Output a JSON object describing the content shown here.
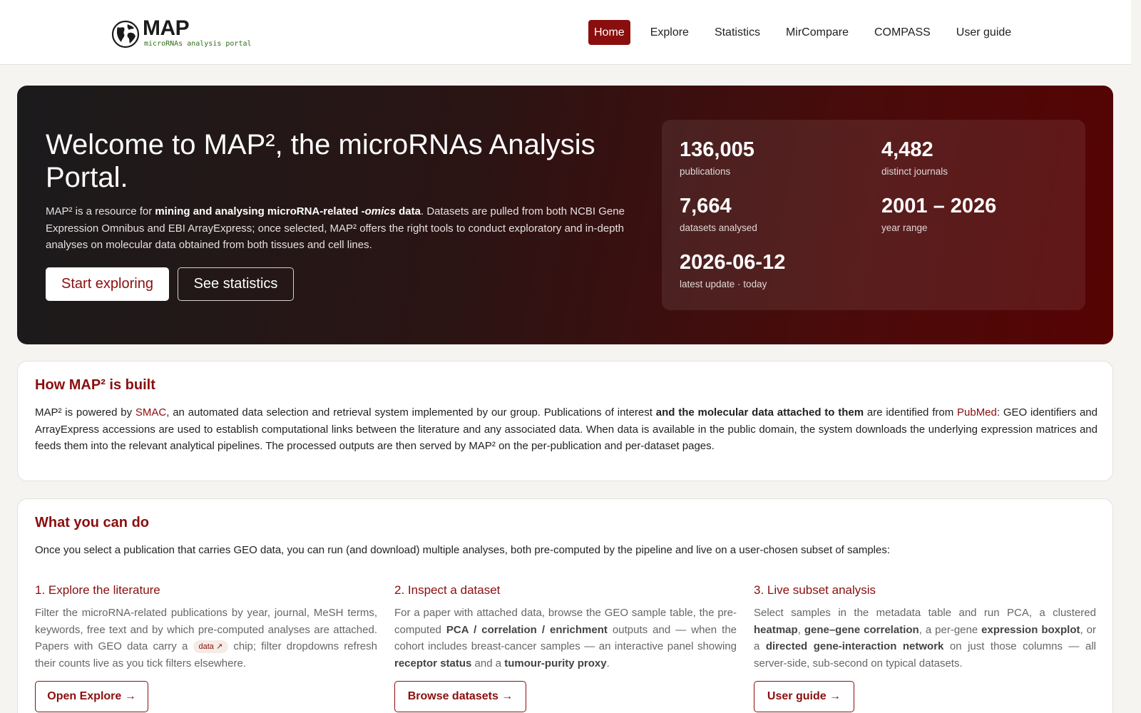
{
  "brand": {
    "logo_text": "MAP",
    "logo_subtitle": "microRNAs analysis portal"
  },
  "nav": [
    {
      "label": "Home",
      "active": true
    },
    {
      "label": "Explore",
      "active": false
    },
    {
      "label": "Statistics",
      "active": false
    },
    {
      "label": "MirCompare",
      "active": false
    },
    {
      "label": "COMPASS",
      "active": false
    },
    {
      "label": "User guide",
      "active": false
    }
  ],
  "hero": {
    "title": "Welcome to MAP², the microRNAs Analysis Portal.",
    "desc_1": "MAP² is a resource for ",
    "desc_bold_1": "mining and analysing microRNA-related ",
    "desc_bold_italic": "-omics",
    "desc_bold_2": " data",
    "desc_2": ". Datasets are pulled from both NCBI Gene Expression Omnibus and EBI ArrayExpress; once selected, MAP² offers the right tools to conduct exploratory and in-depth analyses on molecular data obtained from both tissues and cell lines.",
    "btn_primary": "Start exploring",
    "btn_secondary": "See statistics"
  },
  "stats": [
    {
      "value": "136,005",
      "label": "publications"
    },
    {
      "value": "4,482",
      "label": "distinct journals"
    },
    {
      "value": "7,664",
      "label": "datasets analysed"
    },
    {
      "value": "2001 – 2026",
      "label": "year range"
    },
    {
      "value": "2026-06-12",
      "label": "latest update · today"
    }
  ],
  "built": {
    "title": "How MAP² is built",
    "t1": "MAP² is powered by ",
    "link_smac": "SMAC",
    "t2": ", an automated data selection and retrieval system implemented by our group. Publications of interest ",
    "bold": "and the molecular data attached to them",
    "t3": " are identified from ",
    "link_pubmed": "PubMed",
    "t4": ": GEO identifiers and ArrayExpress accessions are used to establish computational links between the literature and any associated data. When data is available in the public domain, the system downloads the underlying expression matrices and feeds them into the relevant analytical pipelines. The processed outputs are then served by MAP² on the per-publication and per-dataset pages."
  },
  "cando": {
    "title": "What you can do",
    "intro": "Once you select a publication that carries GEO data, you can run (and download) multiple analyses, both pre-computed by the pipeline and live on a user-chosen subset of samples:",
    "col1": {
      "title": "1. Explore the literature",
      "t1": "Filter the microRNA-related publications by year, journal, MeSH terms, keywords, free text and by which pre-computed analyses are attached. Papers with GEO data carry a ",
      "chip": "data ↗",
      "t2": " chip; filter dropdowns refresh their counts live as you tick filters elsewhere.",
      "button": "Open Explore →"
    },
    "col2": {
      "title": "2. Inspect a dataset",
      "t1": "For a paper with attached data, browse the GEO sample table, the pre-computed ",
      "b1": "PCA / correlation / enrichment",
      "t2": " outputs and — when the cohort includes breast-cancer samples — an interactive panel showing ",
      "b2": "receptor status",
      "t3": " and a ",
      "b3": "tumour-purity proxy",
      "t4": ".",
      "button": "Browse datasets →"
    },
    "col3": {
      "title": "3. Live subset analysis",
      "t1": "Select samples in the metadata table and run PCA, a clustered ",
      "b1": "heatmap",
      "t2": ", ",
      "b2": "gene–gene correlation",
      "t3": ", a per-gene ",
      "b3": "expression boxplot",
      "t4": ", or a ",
      "b4": "directed gene-interaction network",
      "t5": " on just those columns — all server-side, sub-second on typical datasets.",
      "button": "User guide →"
    }
  },
  "colors": {
    "accent": "#8b0e0e",
    "hero_dark": "#1b1b1c",
    "hero_red": "#560303"
  }
}
